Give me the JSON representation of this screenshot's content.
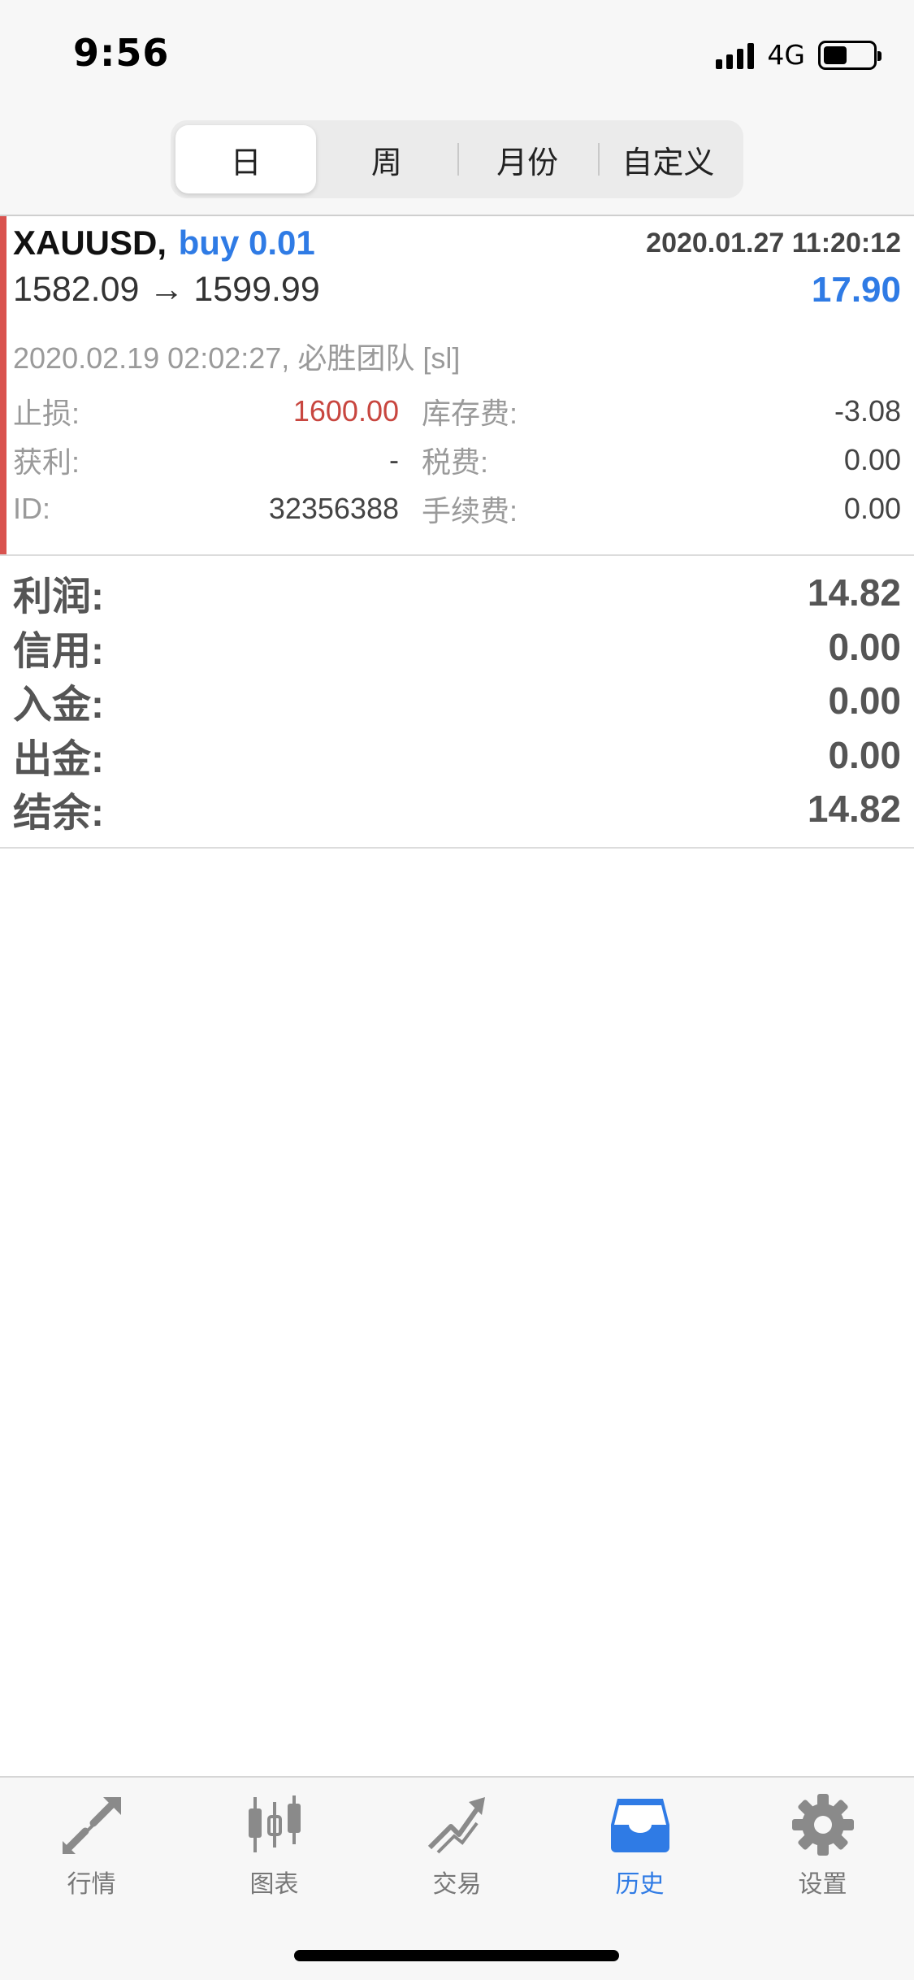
{
  "status_bar": {
    "time": "9:56",
    "network": "4G"
  },
  "period_tabs": [
    {
      "label": "日",
      "active": true
    },
    {
      "label": "周",
      "active": false
    },
    {
      "label": "月份",
      "active": false
    },
    {
      "label": "自定义",
      "active": false
    }
  ],
  "trade": {
    "symbol": "XAUUSD,",
    "side": "buy 0.01",
    "open_time": "2020.01.27 11:20:12",
    "prices": "1582.09 → 1599.99",
    "profit": "17.90",
    "close_info": "2020.02.19 02:02:27, 必胜团队  [sl]",
    "stop_loss_label": "止损:",
    "stop_loss": "1600.00",
    "swap_label": "库存费:",
    "swap": "-3.08",
    "take_profit_label": "获利:",
    "take_profit": "-",
    "tax_label": "税费:",
    "tax": "0.00",
    "id_label": "ID:",
    "id": "32356388",
    "commission_label": "手续费:",
    "commission": "0.00",
    "accent_color": "#d9534f"
  },
  "summary": {
    "profit_label": "利润:",
    "profit": "14.82",
    "credit_label": "信用:",
    "credit": "0.00",
    "deposit_label": "入金:",
    "deposit": "0.00",
    "withdrawal_label": "出金:",
    "withdrawal": "0.00",
    "balance_label": "结余:",
    "balance": "14.82"
  },
  "tab_bar": [
    {
      "label": "行情",
      "icon": "quotes-arrows-icon",
      "active": false
    },
    {
      "label": "图表",
      "icon": "candlestick-chart-icon",
      "active": false
    },
    {
      "label": "交易",
      "icon": "trade-trend-icon",
      "active": false
    },
    {
      "label": "历史",
      "icon": "history-inbox-icon",
      "active": true
    },
    {
      "label": "设置",
      "icon": "gear-icon",
      "active": false
    }
  ],
  "colors": {
    "accent_blue": "#2f7be5",
    "loss_red": "#c8463f"
  }
}
